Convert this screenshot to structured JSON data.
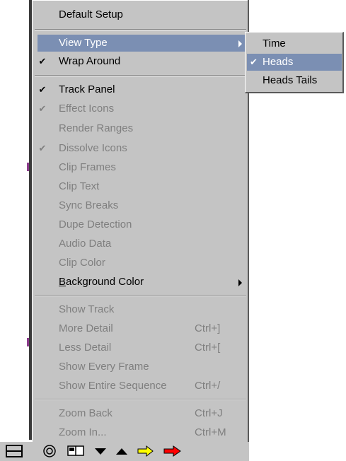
{
  "menu": {
    "items": [
      {
        "label": "Default Setup",
        "check": "",
        "shortcut": "",
        "disabled": false,
        "submenu": false
      },
      {
        "label": "View Type",
        "check": "",
        "shortcut": "",
        "disabled": false,
        "submenu": true,
        "highlight": true
      },
      {
        "label": "Wrap Around",
        "check": "✔",
        "shortcut": "",
        "disabled": false,
        "submenu": false
      },
      {
        "label": "Track Panel",
        "check": "✔",
        "shortcut": "",
        "disabled": false,
        "submenu": false
      },
      {
        "label": "Effect Icons",
        "check": "✔",
        "shortcut": "",
        "disabled": true,
        "submenu": false
      },
      {
        "label": "Render Ranges",
        "check": "",
        "shortcut": "",
        "disabled": true,
        "submenu": false
      },
      {
        "label": "Dissolve Icons",
        "check": "✔",
        "shortcut": "",
        "disabled": true,
        "submenu": false
      },
      {
        "label": "Clip Frames",
        "check": "",
        "shortcut": "",
        "disabled": true,
        "submenu": false
      },
      {
        "label": "Clip Text",
        "check": "",
        "shortcut": "",
        "disabled": true,
        "submenu": false
      },
      {
        "label": "Sync Breaks",
        "check": "",
        "shortcut": "",
        "disabled": true,
        "submenu": false
      },
      {
        "label": "Dupe Detection",
        "check": "",
        "shortcut": "",
        "disabled": true,
        "submenu": false
      },
      {
        "label": "Audio Data",
        "check": "",
        "shortcut": "",
        "disabled": true,
        "submenu": false
      },
      {
        "label": "Clip Color",
        "check": "",
        "shortcut": "",
        "disabled": true,
        "submenu": false
      },
      {
        "label_first": "B",
        "label_rest": "ackground Color",
        "check": "",
        "shortcut": "",
        "disabled": false,
        "submenu": true
      },
      {
        "label": "Show Track",
        "check": "",
        "shortcut": "",
        "disabled": true,
        "submenu": false
      },
      {
        "label": "More Detail",
        "check": "",
        "shortcut": "Ctrl+]",
        "disabled": true,
        "submenu": false
      },
      {
        "label": "Less Detail",
        "check": "",
        "shortcut": "Ctrl+[",
        "disabled": true,
        "submenu": false
      },
      {
        "label": "Show Every Frame",
        "check": "",
        "shortcut": "",
        "disabled": true,
        "submenu": false
      },
      {
        "label": "Show Entire Sequence",
        "check": "",
        "shortcut": "Ctrl+/",
        "disabled": true,
        "submenu": false
      },
      {
        "label": "Zoom Back",
        "check": "",
        "shortcut": "Ctrl+J",
        "disabled": true,
        "submenu": false
      },
      {
        "label": "Zoom In...",
        "check": "",
        "shortcut": "Ctrl+M",
        "disabled": true,
        "submenu": false
      }
    ]
  },
  "submenu": {
    "items": [
      {
        "label": "Time",
        "check": ""
      },
      {
        "label": "Heads",
        "check": "✔",
        "highlight": true
      },
      {
        "label": "Heads Tails",
        "check": ""
      }
    ]
  },
  "toolbar": {
    "icons": [
      "menu-icon",
      "target-icon",
      "monitor-icon",
      "down-arrow-icon",
      "up-arrow-icon",
      "yellow-arrow-icon",
      "red-arrow-icon"
    ],
    "colors": {
      "yellow_arrow": "#ffff00",
      "red_arrow": "#ff0000"
    }
  },
  "colors": {
    "menu_bg": "#c4c4c4",
    "highlight": "#7b8fb3",
    "disabled_text": "#7f7f7f"
  }
}
